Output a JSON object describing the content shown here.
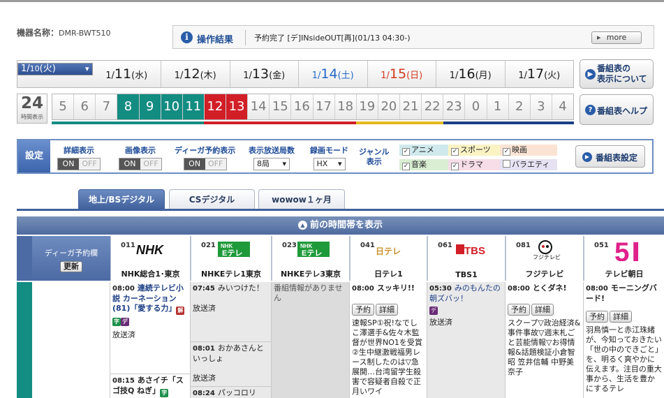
{
  "device": {
    "label": "機器名称：",
    "name": "DMR-BWT510"
  },
  "result": {
    "icon": "info-icon",
    "title": "操作結果",
    "message": "予約完了 [デ]INsideOUT[再](01/13 04:30-)",
    "more": "more"
  },
  "dates": [
    {
      "m": "1",
      "d": "10",
      "w": "(火)",
      "style": "sel"
    },
    {
      "m": "1",
      "d": "11",
      "w": "(水)",
      "style": ""
    },
    {
      "m": "1",
      "d": "12",
      "w": "(木)",
      "style": ""
    },
    {
      "m": "1",
      "d": "13",
      "w": "(金)",
      "style": ""
    },
    {
      "m": "1",
      "d": "14",
      "w": "(土)",
      "style": "sat"
    },
    {
      "m": "1",
      "d": "15",
      "w": "(日)",
      "style": "sun"
    },
    {
      "m": "1",
      "d": "16",
      "w": "(月)",
      "style": ""
    },
    {
      "m": "1",
      "d": "17",
      "w": "(火)",
      "style": ""
    }
  ],
  "side_buttons": {
    "display": "番組表の\n表示について",
    "help": "番組表ヘルプ"
  },
  "hours24": {
    "num": "24",
    "label": "時間表示"
  },
  "hours": [
    {
      "h": "5",
      "s": ""
    },
    {
      "h": "6",
      "s": ""
    },
    {
      "h": "7",
      "s": ""
    },
    {
      "h": "8",
      "s": "now"
    },
    {
      "h": "9",
      "s": "now"
    },
    {
      "h": "10",
      "s": "now"
    },
    {
      "h": "11",
      "s": "now"
    },
    {
      "h": "12",
      "s": "red"
    },
    {
      "h": "13",
      "s": "red"
    },
    {
      "h": "14",
      "s": ""
    },
    {
      "h": "15",
      "s": ""
    },
    {
      "h": "16",
      "s": ""
    },
    {
      "h": "17",
      "s": ""
    },
    {
      "h": "18",
      "s": ""
    },
    {
      "h": "19",
      "s": ""
    },
    {
      "h": "20",
      "s": ""
    },
    {
      "h": "21",
      "s": ""
    },
    {
      "h": "22",
      "s": ""
    },
    {
      "h": "23",
      "s": ""
    },
    {
      "h": "0",
      "s": ""
    },
    {
      "h": "1",
      "s": ""
    },
    {
      "h": "2",
      "s": ""
    },
    {
      "h": "3",
      "s": ""
    },
    {
      "h": "4",
      "s": ""
    }
  ],
  "hourbar_colors": [
    "#138c82",
    "#138c82",
    "#138c82",
    "#138c82",
    "#138c82",
    "#138c82",
    "#138c82",
    "#d21e26",
    "#d21e26",
    "#d21e26",
    "#d21e26",
    "#d21e26",
    "#d21e26",
    "#d21e26",
    "#e6b820",
    "#e6b820",
    "#e6b820",
    "#e6b820",
    "#1a3f86",
    "#1a3f86",
    "#1a3f86",
    "#1a3f86",
    "#1a3f86",
    "#1a3f86"
  ],
  "settings": {
    "head": "設定",
    "detail": "詳細表示",
    "image": "画像表示",
    "diga": "ディーガ予約表示",
    "count_label": "表示放送局数",
    "count_value": "8局",
    "mode_label": "録画モード",
    "mode_value": "HX",
    "genre_label": "ジャンル\n表示",
    "on": "ON",
    "off": "OFF",
    "genres": [
      {
        "name": "アニメ",
        "checked": "✓",
        "color": "#cfe9ec"
      },
      {
        "name": "スポーツ",
        "checked": "✓",
        "color": "#fbf3c4"
      },
      {
        "name": "映画",
        "checked": "✓",
        "color": "#fbe3d3"
      },
      {
        "name": "音楽",
        "checked": "✓",
        "color": "#d9eed2"
      },
      {
        "name": "ドラマ",
        "checked": "✓",
        "color": "#f6dde8"
      },
      {
        "name": "バラエティ",
        "checked": "",
        "color": "#e6e2f3"
      }
    ],
    "button": "番組表設定"
  },
  "tabs": [
    "地上/BSデジタル",
    "CSデジタル",
    "wowow１ヶ月"
  ],
  "prev": "前の時間帯を表示",
  "diga_col": {
    "title": "ディーガ予約欄",
    "button": "更新"
  },
  "channels": [
    {
      "num": "011",
      "logo": "NHK",
      "name": "NHK総合1･東京"
    },
    {
      "num": "021",
      "logo": "NHK Eテレ",
      "name": "NHKEテレ1東京"
    },
    {
      "num": "023",
      "logo": "NHK Eテレ",
      "name": "NHKEテレ3東京"
    },
    {
      "num": "041",
      "logo": "日テレ",
      "name": "日テレ1"
    },
    {
      "num": "061",
      "logo": "TBS",
      "name": "TBS1"
    },
    {
      "num": "081",
      "logo": "フジテレビ",
      "name": "フジテレビ"
    },
    {
      "num": "051",
      "logo": "5",
      "name": "テレビ朝日"
    }
  ],
  "programs": {
    "nhk1": {
      "time": "08:00",
      "title": "連続テレビ小説 カーネーション(81)「愛する力」",
      "status": "放送済"
    },
    "nhk2": {
      "time": "08:15",
      "title": "あさイチ「スゴ技Q ねぎ」"
    },
    "etv1a": {
      "time": "07:45",
      "title": "みいつけた！",
      "status": "放送済"
    },
    "etv1b": {
      "time": "08:01",
      "title": "おかあさんといっしょ",
      "status": "放送済"
    },
    "etv1c": {
      "time": "08:24",
      "title": "パッコロリ"
    },
    "etv3": {
      "msg": "番組情報がありません"
    },
    "ntv": {
      "time": "08:00",
      "title": "スッキリ!!",
      "desc": "速報SP①祝!なでしこ澤選手&佐々木監督が世界NO1を受賞②生中継激戦福男レース制したのは▽急展開…台湾留学生殺害で容疑者自殺で正月いワイ"
    },
    "tbs": {
      "time": "05:30",
      "title": "みのもんたの朝ズバッ！",
      "status": "放送済"
    },
    "cx": {
      "time": "08:00",
      "title": "とくダネ!",
      "desc": "スクープ▽政治経済&事件事故▽週末札ごと芸能情報▽お得情報&話題検証小倉智昭 笠井信輔 中野美奈子"
    },
    "ex": {
      "time": "08:00",
      "title": "モーニングバード!",
      "desc": "羽鳥慎一と赤江珠緒が、今知っておきたい「世の中のできごと」を、明るく爽やかに伝えます。注目の重大事から、生活を豊かにするテレ"
    }
  },
  "btn": {
    "reserve": "予約",
    "detail": "詳細"
  },
  "badges": {
    "kai": "解",
    "ji": "字",
    "de": "デ"
  }
}
